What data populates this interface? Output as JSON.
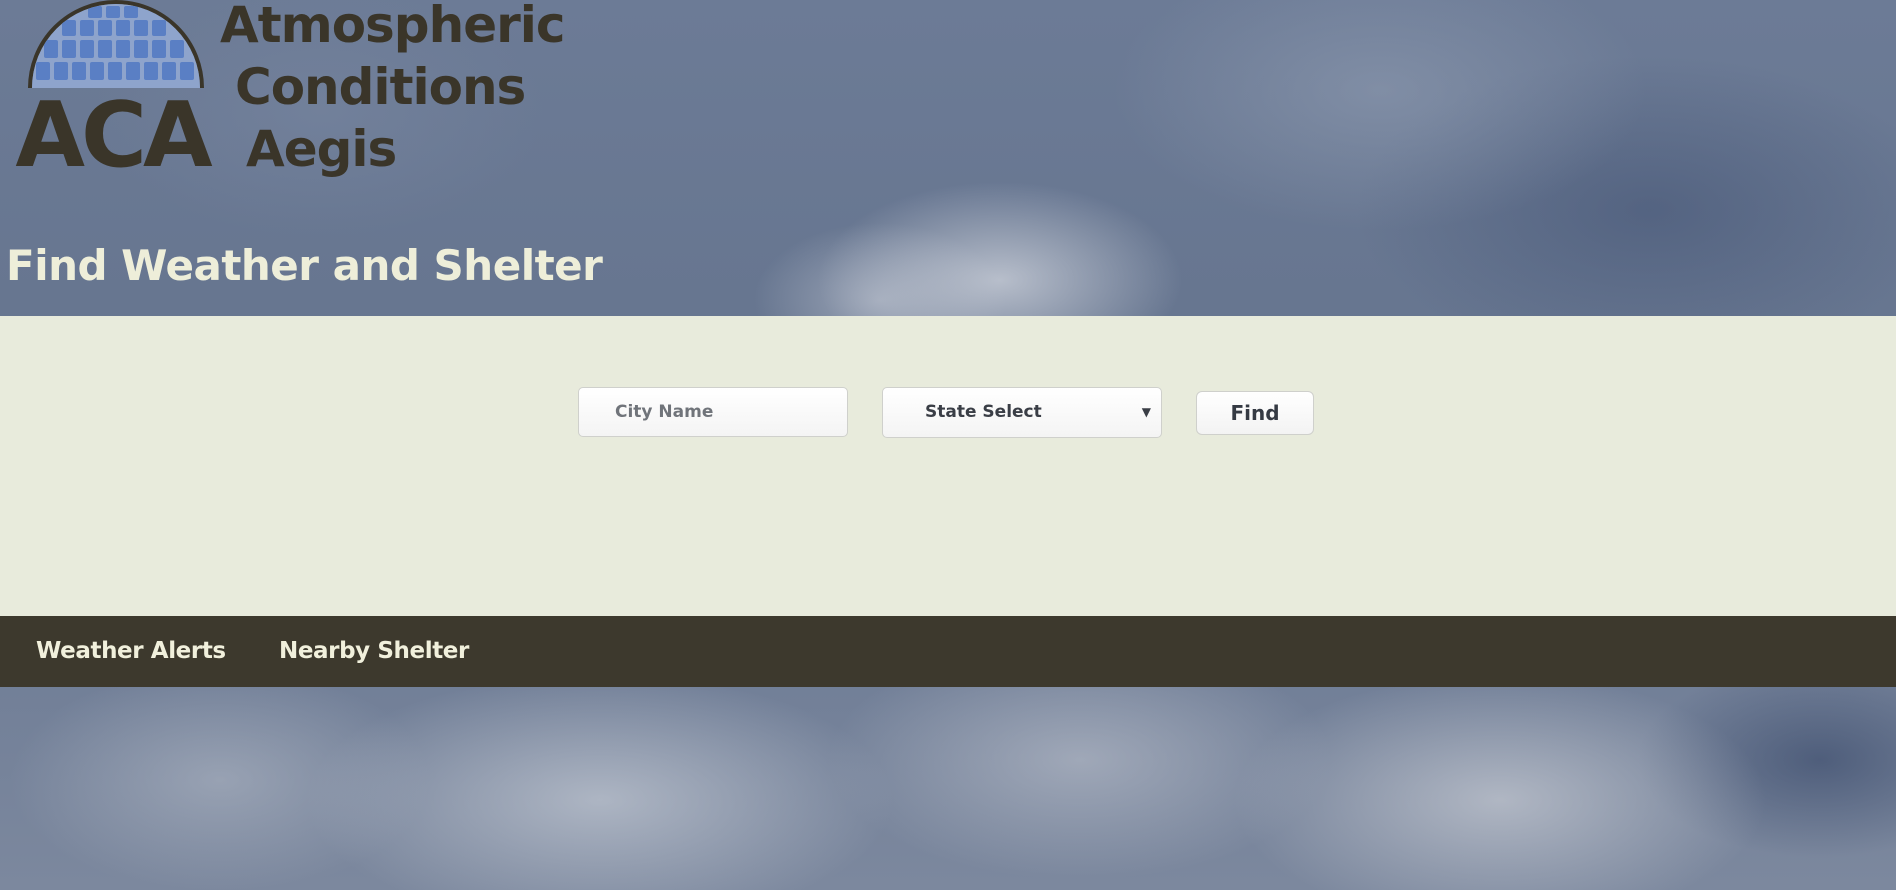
{
  "brand": {
    "logo_letters": "ACA",
    "name_lines": [
      "Atmospheric",
      "Conditions",
      "Aegis"
    ],
    "colors": {
      "logo_text": "#3a3529",
      "globe_blue": "#5a7fc4"
    }
  },
  "header": {
    "title": "Find Weather and Shelter"
  },
  "search": {
    "city_placeholder": "City Name",
    "city_value": "",
    "state_selected": "State Select",
    "find_label": "Find"
  },
  "nav": {
    "items": [
      {
        "label": "Weather Alerts"
      },
      {
        "label": "Nearby Shelter"
      }
    ]
  },
  "colors": {
    "search_band": "#e8ebdc",
    "nav_bar": "#3d392d",
    "nav_text": "#f1f0dc",
    "title_text": "#eeeed9"
  }
}
